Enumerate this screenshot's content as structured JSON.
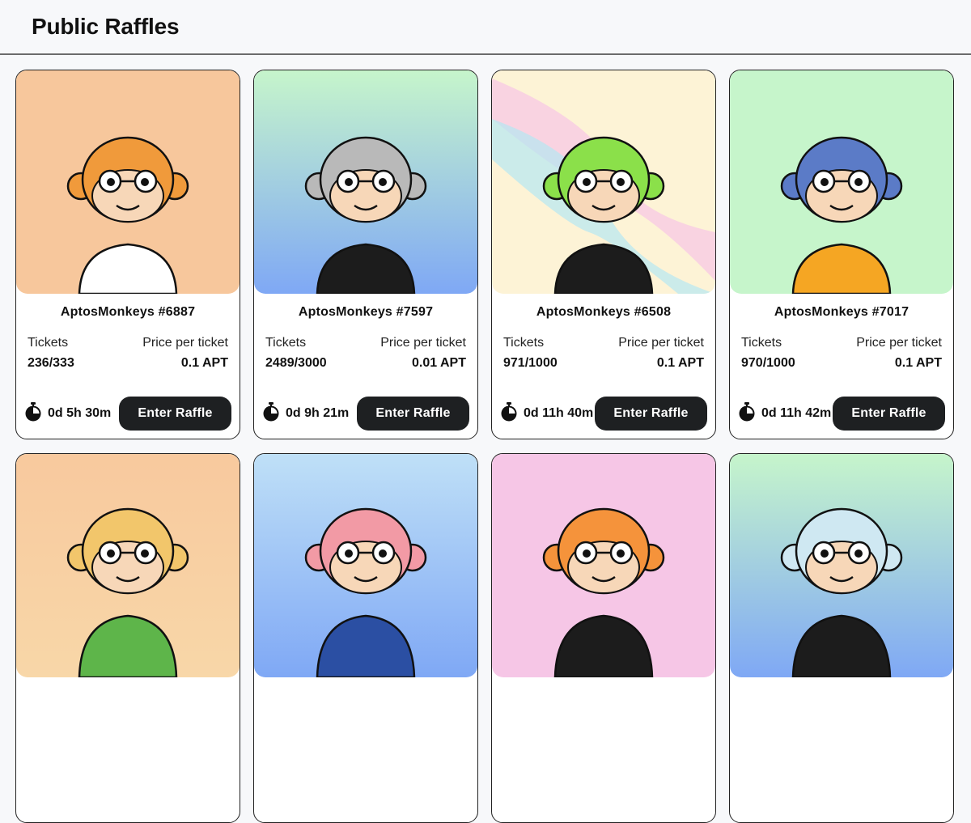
{
  "page": {
    "title": "Public Raffles"
  },
  "labels": {
    "tickets": "Tickets",
    "price": "Price per ticket",
    "enter": "Enter Raffle"
  },
  "raffles": [
    {
      "name": "AptosMonkeys #6887",
      "tickets": "236/333",
      "price": "0.1 APT",
      "time": "0d 5h 30m",
      "bg": "#f7c79c",
      "fur": "#f09a3b"
    },
    {
      "name": "AptosMonkeys #7597",
      "tickets": "2489/3000",
      "price": "0.01 APT",
      "time": "0d 9h 21m",
      "bg": "#c6f5cb",
      "fur": "#b9b9b9"
    },
    {
      "name": "AptosMonkeys #6508",
      "tickets": "971/1000",
      "price": "0.1 APT",
      "time": "0d 11h 40m",
      "bg": "#fdf3d6",
      "fur": "#8be04a"
    },
    {
      "name": "AptosMonkeys #7017",
      "tickets": "970/1000",
      "price": "0.1 APT",
      "time": "0d 11h 42m",
      "bg": "#c6f5cb",
      "fur": "#5b7bc7"
    },
    {
      "name": "",
      "tickets": "",
      "price": "",
      "time": "",
      "bg": "#f8c99e",
      "fur": "#f2c66b"
    },
    {
      "name": "",
      "tickets": "",
      "price": "",
      "time": "",
      "bg": "#bfe0f7",
      "fur": "#f29aa5"
    },
    {
      "name": "",
      "tickets": "",
      "price": "",
      "time": "",
      "bg": "#f6c6e6",
      "fur": "#f5933b"
    },
    {
      "name": "",
      "tickets": "",
      "price": "",
      "time": "",
      "bg": "#c6f5cb",
      "fur": "#cfe8f2"
    }
  ]
}
